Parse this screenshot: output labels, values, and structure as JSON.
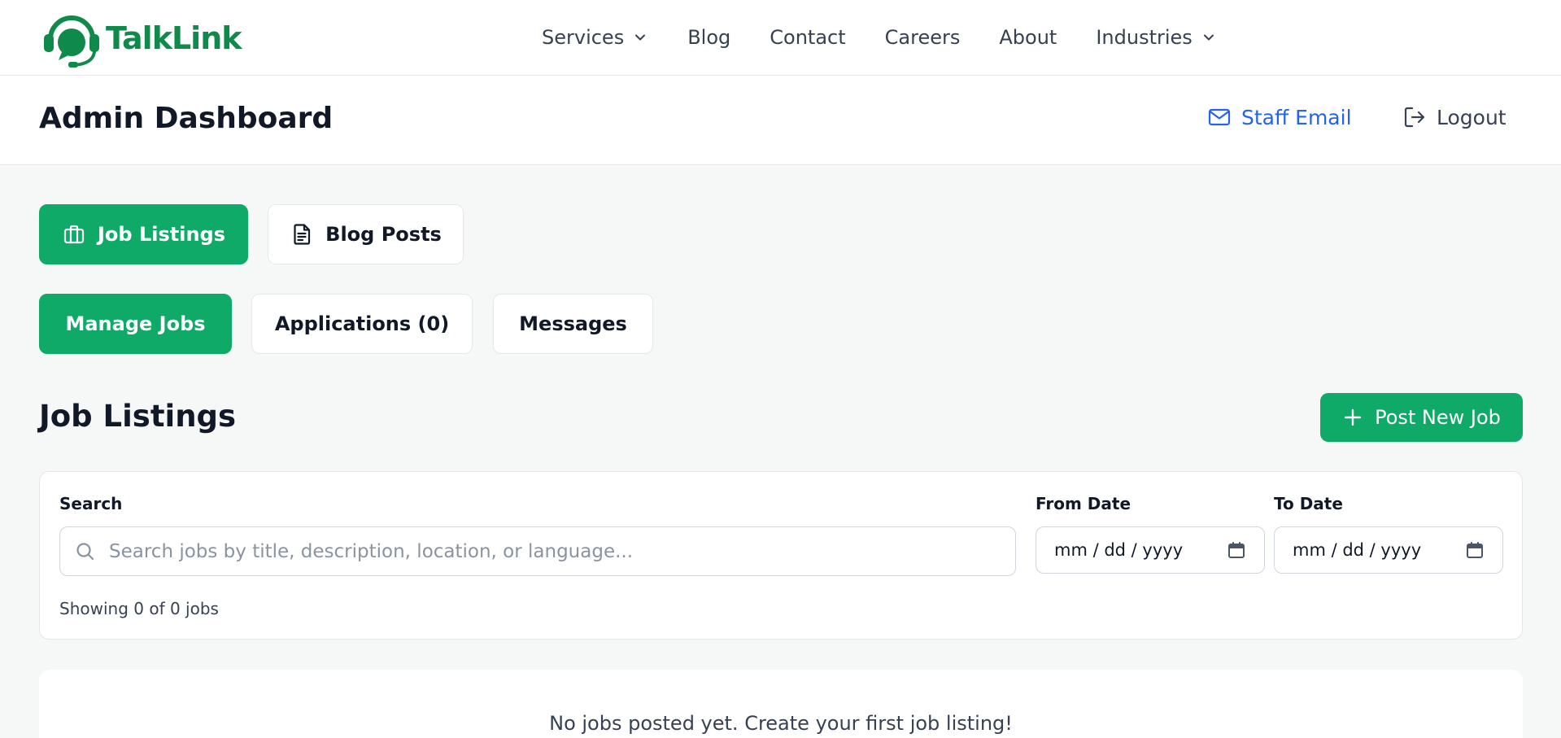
{
  "brand": {
    "name": "TalkLink",
    "color": "#0f8a4a",
    "logo_icon": "headset-chat-icon"
  },
  "nav": {
    "items": [
      {
        "label": "Services",
        "has_dropdown": true
      },
      {
        "label": "Blog",
        "has_dropdown": false
      },
      {
        "label": "Contact",
        "has_dropdown": false
      },
      {
        "label": "Careers",
        "has_dropdown": false
      },
      {
        "label": "About",
        "has_dropdown": false
      },
      {
        "label": "Industries",
        "has_dropdown": true
      }
    ]
  },
  "header": {
    "title": "Admin Dashboard",
    "staff_email_label": "Staff Email",
    "logout_label": "Logout"
  },
  "main_tabs": [
    {
      "label": "Job Listings",
      "icon": "briefcase-icon",
      "active": true
    },
    {
      "label": "Blog Posts",
      "icon": "document-icon",
      "active": false
    }
  ],
  "sub_tabs": [
    {
      "label": "Manage Jobs",
      "active": true
    },
    {
      "label": "Applications (0)",
      "active": false
    },
    {
      "label": "Messages",
      "active": false
    }
  ],
  "section": {
    "title": "Job Listings",
    "post_button_label": "Post New Job"
  },
  "filters": {
    "search_label": "Search",
    "search_placeholder": "Search jobs by title, description, location, or language...",
    "search_value": "",
    "from_label": "From Date",
    "from_value": "mm / dd / yyyy",
    "to_label": "To Date",
    "to_value": "mm / dd / yyyy",
    "showing_text": "Showing 0 of 0 jobs"
  },
  "empty_state": {
    "message": "No jobs posted yet. Create your first job listing!"
  },
  "colors": {
    "accent": "#0fa968",
    "link": "#2563eb",
    "background": "#f6f8f7"
  }
}
